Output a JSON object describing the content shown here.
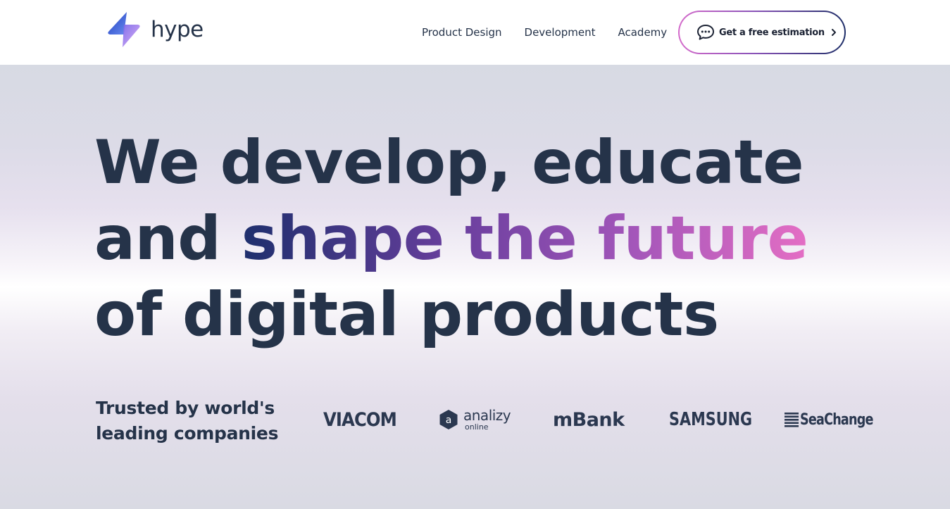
{
  "header": {
    "logo": {
      "icon": "lightning-bolt-logo",
      "text": "hype"
    },
    "nav": [
      {
        "label": "Product Design"
      },
      {
        "label": "Development"
      },
      {
        "label": "Academy"
      }
    ],
    "cta": {
      "label": "Get a free estimation",
      "icon": "chat-bubble-icon",
      "arrow_icon": "chevron-right-icon"
    }
  },
  "hero": {
    "headline": {
      "line1": "We develop, educate",
      "line2_plain": "and",
      "line2_highlight": "shape the future",
      "line3": "of digital products"
    },
    "trusted": {
      "line1": "Trusted by world's",
      "line2": "leading companies"
    },
    "client_logos": [
      {
        "name": "viacom",
        "text": "VIACOM"
      },
      {
        "name": "analizy",
        "text": "analizy",
        "subtext": "online",
        "badge": "a"
      },
      {
        "name": "mbank",
        "text": "mBank"
      },
      {
        "name": "samsung",
        "text": "SAMSUNG"
      },
      {
        "name": "seachange",
        "text": "SeaChange"
      }
    ]
  },
  "colors": {
    "text_dark": "#253349",
    "gradient_start": "#1e2f6d",
    "gradient_mid": "#a155b9",
    "gradient_end": "#e46ec4",
    "hero_bg_edge": "#d7dae3"
  }
}
